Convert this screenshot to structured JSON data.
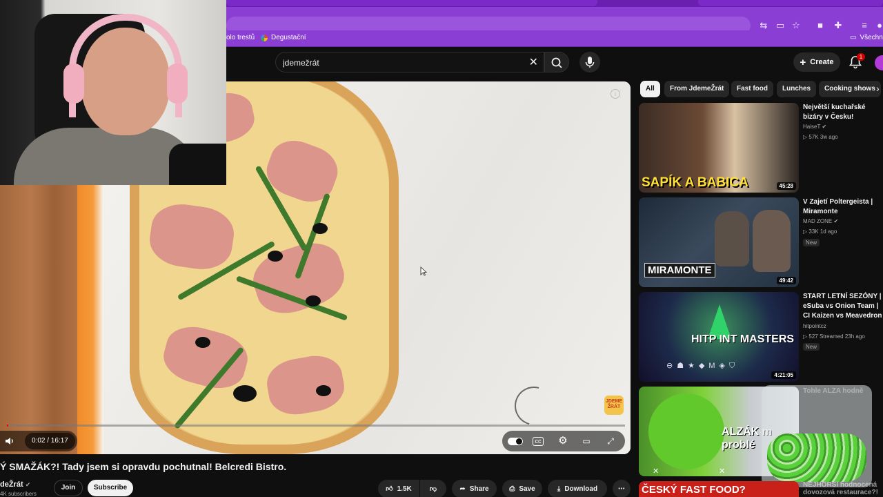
{
  "browser": {
    "bookmarks": [
      {
        "label": "olo trestů",
        "icon": "bookmark-folder-icon"
      },
      {
        "label": "Degustační",
        "icon": "google-photos-icon"
      },
      {
        "label": "Všechny",
        "icon": "folder-icon"
      }
    ],
    "colors": {
      "chrome": "#8a3ed3",
      "tabstrip": "#6a1fb0"
    }
  },
  "header": {
    "search_value": "jdemežrát",
    "create_label": "Create",
    "notification_count": "1"
  },
  "player": {
    "time": "0:02 / 16:17",
    "progress_fraction": 0.002,
    "watermark": "JDEME ŽRÁT"
  },
  "chips": [
    "All",
    "From JdemeŽrát",
    "Fast food",
    "Lunches",
    "Cooking shows"
  ],
  "recommendations": [
    {
      "title": "Největší kuchařské bizáry v Česku!",
      "channel": "HaiseT",
      "verified": true,
      "meta": "▷ 57K  3w ago",
      "duration": "45:28",
      "thumb_text": "SAPÍK A BABICA",
      "is_new": false
    },
    {
      "title": "V Zajetí Poltergeista | Miramonte",
      "channel": "MAD ZONE",
      "verified": true,
      "meta": "▷ 33K  1d ago",
      "duration": "49:42",
      "thumb_text": "MIRAMONTE",
      "is_new": true,
      "new_label": "New"
    },
    {
      "title": "START LETNÍ SEZÓNY | eSuba vs Onion Team | CI Kaizen vs Meavedron | BO",
      "channel": "hitpointcz",
      "verified": false,
      "meta": "▷ 527  Streamed 23h ago",
      "duration": "4:21:05",
      "thumb_text": "HITP INT MASTERS",
      "is_new": true,
      "new_label": "New"
    },
    {
      "title": "Tohle ALZA hodně p***ala",
      "channel": "",
      "verified": false,
      "meta": "",
      "duration": "",
      "thumb_text": "ALZÁK m problé",
      "is_new": false
    },
    {
      "title": "NEJHORŠÍ hodnocená dovozová restaurace?! N",
      "channel": "",
      "verified": false,
      "meta": "",
      "duration": "",
      "thumb_text": "ČESKÝ FAST FOOD?",
      "is_new": false
    }
  ],
  "video": {
    "title": "Ý SMAŽÁK?! Tady jsem si opravdu pochutnal! Belcredi Bistro.",
    "channel": "deŽrát",
    "subscribers": "4K subscribers",
    "join_label": "Join",
    "subscribe_label": "Subscribe",
    "likes": "1.5K",
    "share_label": "Share",
    "save_label": "Save",
    "download_label": "Download"
  }
}
